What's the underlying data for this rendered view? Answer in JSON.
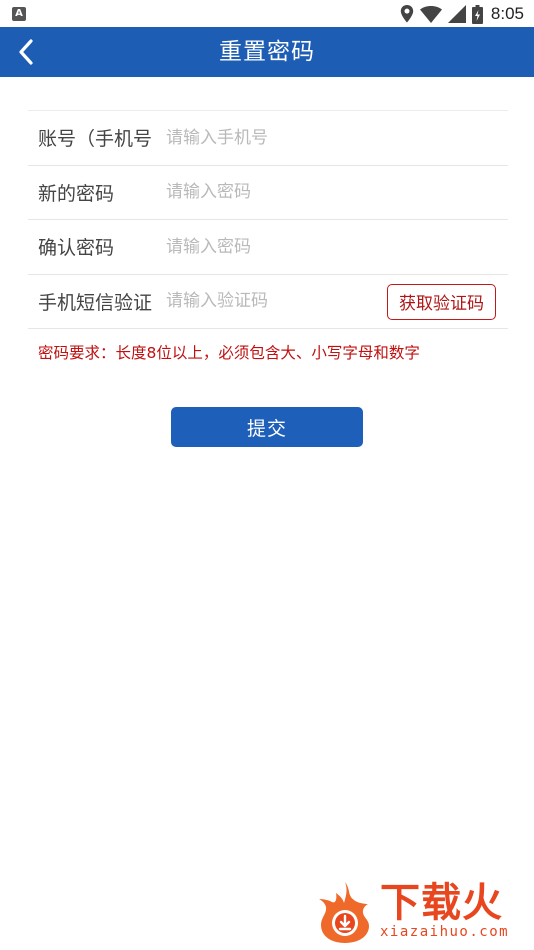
{
  "status_bar": {
    "badge": "A",
    "time": "8:05",
    "icons": [
      "location-icon",
      "wifi-icon",
      "signal-icon",
      "battery-icon"
    ]
  },
  "header": {
    "title": "重置密码",
    "back_icon": "chevron-left-icon",
    "background_color": "#1d5db3"
  },
  "form": {
    "rows": [
      {
        "label": "账号（手机号",
        "placeholder": "请输入手机号",
        "value": ""
      },
      {
        "label": "新的密码",
        "placeholder": "请输入密码",
        "value": ""
      },
      {
        "label": "确认密码",
        "placeholder": "请输入密码",
        "value": ""
      },
      {
        "label": "手机短信验证",
        "placeholder": "请输入验证码",
        "value": ""
      }
    ],
    "get_code_label": "获取验证码"
  },
  "hint": {
    "text": "密码要求：长度8位以上，必须包含大、小写字母和数字",
    "color": "#c01010"
  },
  "submit": {
    "label": "提交",
    "color": "#1e5fba"
  },
  "watermark": {
    "brand": "下载火",
    "domain": "xiazaihuo.com"
  }
}
